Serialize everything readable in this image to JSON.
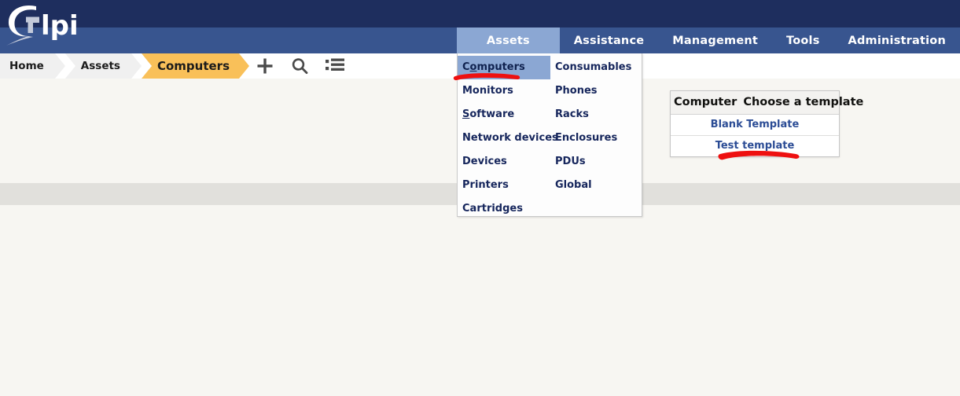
{
  "app": {
    "logo_text": "lpi",
    "logo_name": "glpi-logo"
  },
  "menu": {
    "tabs": [
      {
        "label": "Assets",
        "active": true
      },
      {
        "label": "Assistance",
        "active": false
      },
      {
        "label": "Management",
        "active": false
      },
      {
        "label": "Tools",
        "active": false
      },
      {
        "label": "Administration",
        "active": false
      }
    ]
  },
  "breadcrumb": {
    "items": [
      {
        "label": "Home",
        "current": false
      },
      {
        "label": "Assets",
        "current": false
      },
      {
        "label": "Computers",
        "current": true
      }
    ],
    "icons": [
      {
        "name": "add-icon",
        "glyph": "+"
      },
      {
        "name": "search-icon",
        "glyph": "search"
      },
      {
        "name": "list-icon",
        "glyph": "list"
      }
    ]
  },
  "dropdown": {
    "left_column": [
      {
        "label": "Computers",
        "accesskey": "o",
        "highlighted": true
      },
      {
        "label": "Monitors",
        "accesskey": "",
        "highlighted": false
      },
      {
        "label": "Software",
        "accesskey": "S",
        "highlighted": false
      },
      {
        "label": "Network devices",
        "accesskey": "",
        "highlighted": false
      },
      {
        "label": "Devices",
        "accesskey": "",
        "highlighted": false
      },
      {
        "label": "Printers",
        "accesskey": "",
        "highlighted": false
      },
      {
        "label": "Cartridges",
        "accesskey": "",
        "highlighted": false
      }
    ],
    "right_column": [
      {
        "label": "Consumables",
        "highlighted": false
      },
      {
        "label": "Phones",
        "highlighted": false
      },
      {
        "label": "Racks",
        "highlighted": false
      },
      {
        "label": "Enclosures",
        "highlighted": false
      },
      {
        "label": "PDUs",
        "highlighted": false
      },
      {
        "label": "Global",
        "highlighted": false
      }
    ]
  },
  "template_panel": {
    "item_type": "Computer",
    "title": "Choose a template",
    "rows": [
      {
        "label": "Blank Template"
      },
      {
        "label": "Test template"
      }
    ]
  },
  "annotations": [
    {
      "name": "red-underline-computers-menu",
      "target": "Computers"
    },
    {
      "name": "red-underline-test-template",
      "target": "Test template"
    }
  ],
  "colors": {
    "navy": "#1e2e5e",
    "menu_blue": "#38558f",
    "tab_active": "#8ba7d3",
    "crumb_current": "#f9c059",
    "link_blue": "#2b4c95",
    "annotation_red": "#ee1111",
    "body_bg": "#f7f6f2",
    "strip_grey": "#e1e0dc"
  }
}
